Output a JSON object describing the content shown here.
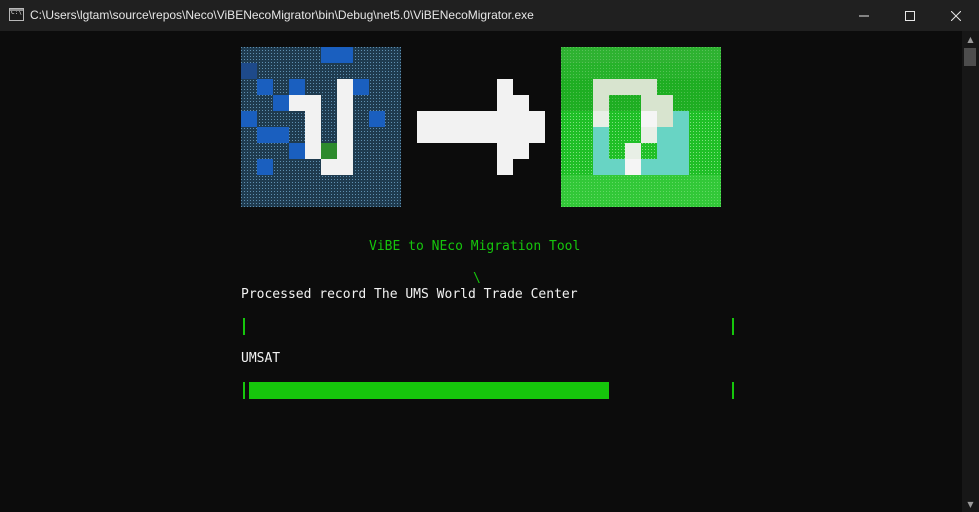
{
  "window": {
    "title": "C:\\Users\\lgtam\\source\\repos\\Neco\\ViBENecoMigrator\\bin\\Debug\\net5.0\\ViBENecoMigrator.exe",
    "icon": "console-app-icon",
    "icon_label": "C:\\",
    "minimize_icon": "minimize-icon",
    "maximize_icon": "maximize-icon",
    "close_icon": "close-icon"
  },
  "console": {
    "heading": "ViBE to NEco Migration Tool",
    "spinner": "\\",
    "status_line": "Processed record The UMS World Trade Center",
    "current_item": "UMSAT",
    "progress_bars": [
      {
        "name": "record-progress",
        "progress": 0.0
      },
      {
        "name": "site-progress",
        "progress": 0.74
      }
    ],
    "colors": {
      "background": "#0c0c0c",
      "accent_green": "#16c60c",
      "text": "#f2f2f2",
      "vibe_blue": "#1a5fbf",
      "neco_green": "#22c22a"
    }
  },
  "scrollbar": {
    "up_icon": "chevron-up-icon",
    "down_icon": "chevron-down-icon"
  }
}
